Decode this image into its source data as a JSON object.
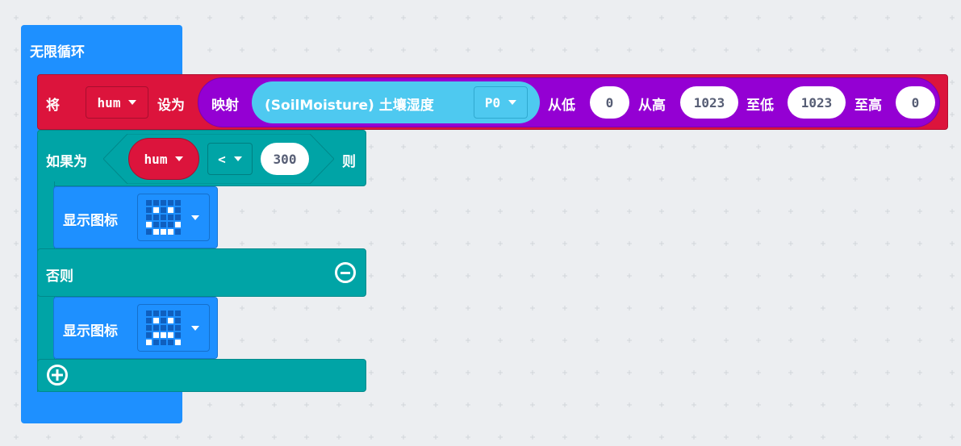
{
  "forever": {
    "label": "无限循环"
  },
  "set_block": {
    "prefix": "将",
    "variable": "hum",
    "to": "设为",
    "map_label": "映射",
    "sensor": "(SoilMoisture) 土壤湿度",
    "pin": "P0",
    "from_low_label": "从低",
    "from_low": "0",
    "from_high_label": "从高",
    "from_high": "1023",
    "to_low_label": "至低",
    "to_low": "1023",
    "to_high_label": "至高",
    "to_high": "0"
  },
  "if_block": {
    "if_label": "如果为",
    "variable": "hum",
    "operator": "<",
    "value": "300",
    "then_label": "则",
    "else_label": "否则"
  },
  "show_icon_1": {
    "label": "显示图标",
    "icon": "smiley-icon"
  },
  "show_icon_2": {
    "label": "显示图标",
    "icon": "sad-icon"
  },
  "icons": {
    "minus": "minus-circle-icon",
    "plus": "plus-circle-icon",
    "dropdown": "dropdown-caret-icon"
  },
  "colors": {
    "loops": "#1e90ff",
    "variables": "#dc143c",
    "math": "#9400d3",
    "sensor": "#4ec9f0",
    "logic": "#00a4a6"
  }
}
